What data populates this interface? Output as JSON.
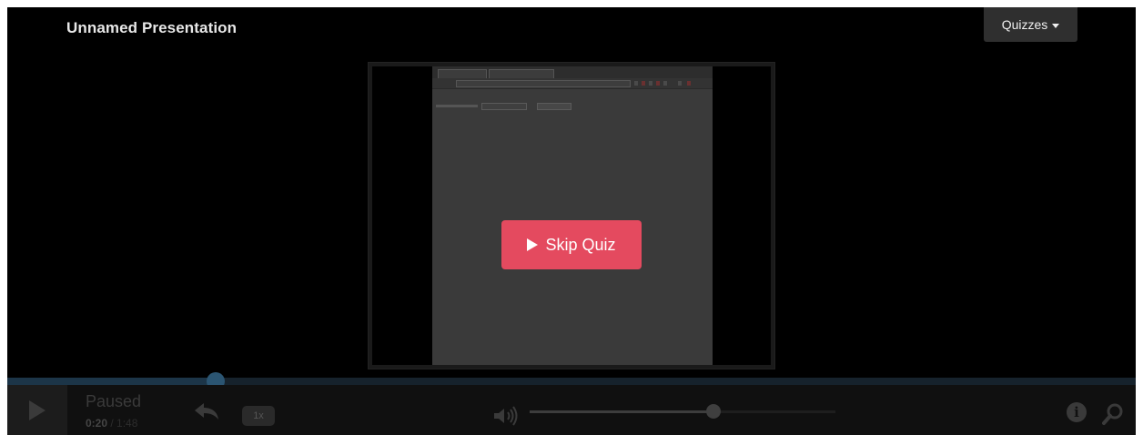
{
  "header": {
    "title": "Unnamed Presentation",
    "quizzes_label": "Quizzes"
  },
  "overlay": {
    "skip_quiz_label": "Skip Quiz",
    "accent_color": "#e44a5f"
  },
  "player": {
    "status": "Paused",
    "current_time": "0:20",
    "separator": " / ",
    "total_time": "1:48",
    "speed_label": "1x",
    "progress_fraction": 0.185,
    "volume_fraction": 0.6
  },
  "icons": {
    "play": "play-icon",
    "rewind": "rewind-icon",
    "volume": "volume-icon",
    "info": "info-icon",
    "search": "search-icon",
    "caret": "chevron-down-icon",
    "info_glyph": "i"
  }
}
